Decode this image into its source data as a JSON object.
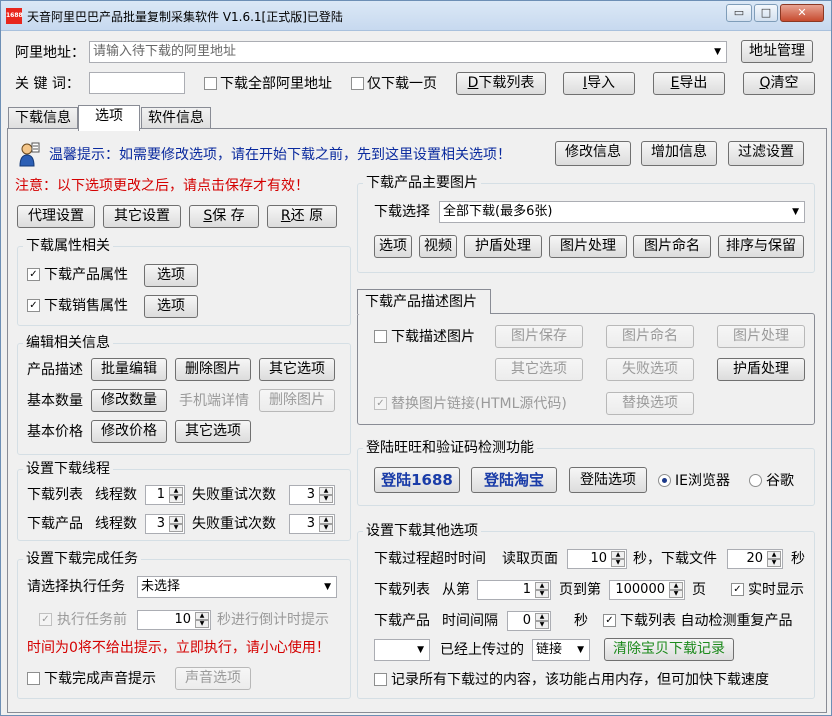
{
  "window": {
    "title": "天音阿里巴巴产品批量复制采集软件 V1.6.1[正式版]已登陆",
    "icon_text": "1688",
    "min_glyph": "▭",
    "max_glyph": "□",
    "close_glyph": "✕"
  },
  "top": {
    "address_label": "阿里地址：",
    "address_placeholder": "请输入待下载的阿里地址",
    "address_manage_btn": "地址管理",
    "keyword_label": "关 键 词：",
    "keyword_value": "",
    "download_all_label": "下载全部阿里地址",
    "download_all_checked": false,
    "only_one_page_label": "仅下载一页",
    "only_one_page_checked": false,
    "download_list_key": "D",
    "download_list_btn": "下载列表",
    "import_key": "I",
    "import_btn": "导入",
    "export_key": "E",
    "export_btn": "导出",
    "clear_key": "Q",
    "clear_btn": "清空"
  },
  "tabs": [
    "下载信息",
    "选项",
    "软件信息"
  ],
  "active_tab": "选项",
  "tip": {
    "text": "温馨提示：如需要修改选项，请在开始下载之前，先到这里设置相关选项！",
    "modify_btn": "修改信息",
    "add_btn": "增加信息",
    "filter_btn": "过滤设置"
  },
  "notice": "注意：以下选项更改之后，请点击保存才有效！",
  "actions": {
    "proxy_btn": "代理设置",
    "other_btn": "其它设置",
    "save_key": "S",
    "save_btn": "保 存",
    "restore_key": "R",
    "restore_btn": "还 原"
  },
  "download_attr": {
    "title": "下载属性相关",
    "product_attr_label": "下载产品属性",
    "product_attr_checked": true,
    "sale_attr_label": "下载销售属性",
    "sale_attr_checked": true,
    "option_btn": "选项"
  },
  "edit_info": {
    "title": "编辑相关信息",
    "desc_label": "产品描述",
    "batch_edit_btn": "批量编辑",
    "delete_img_btn": "删除图片",
    "other_option_btn": "其它选项",
    "qty_label": "基本数量",
    "modify_qty_btn": "修改数量",
    "mobile_detail_label": "手机端详情",
    "mobile_delete_img_btn": "删除图片",
    "price_label": "基本价格",
    "modify_price_btn": "修改价格",
    "price_other_btn": "其它选项"
  },
  "threads": {
    "title": "设置下载线程",
    "list_label": "下载列表",
    "product_label": "下载产品",
    "thread_label": "线程数",
    "retry_label": "失败重试次数",
    "list_threads": 1,
    "list_retry": 3,
    "product_threads": 3,
    "product_retry": 3
  },
  "complete_task": {
    "title": "设置下载完成任务",
    "select_label": "请选择执行任务",
    "select_value": "未选择",
    "countdown_before": "执行任务前",
    "countdown_value": 10,
    "countdown_after": "秒进行倒计时提示",
    "countdown_checked": true,
    "warning": "时间为0将不给出提示，立即执行，请小心使用！",
    "sound_label": "下载完成声音提示",
    "sound_checked": false,
    "sound_btn": "声音选项"
  },
  "main_image": {
    "title": "下载产品主要图片",
    "select_label": "下载选择",
    "select_value": "全部下载(最多6张)",
    "buttons": [
      "选项",
      "视频",
      "护盾处理",
      "图片处理",
      "图片命名",
      "排序与保留"
    ]
  },
  "desc_image": {
    "title": "下载产品描述图片",
    "download_label": "下载描述图片",
    "download_checked": false,
    "save_btn": "图片保存",
    "name_btn": "图片命名",
    "process_btn": "图片处理",
    "other_btn": "其它选项",
    "fail_btn": "失败选项",
    "shield_btn": "护盾处理",
    "replace_label": "替换图片链接(HTML源代码)",
    "replace_checked": true,
    "replace_btn": "替换选项"
  },
  "login": {
    "title": "登陆旺旺和验证码检测功能",
    "login1688_btn": "登陆1688",
    "taobao_btn": "登陆淘宝",
    "option_btn": "登陆选项",
    "ie_label": "IE浏览器",
    "chrome_label": "谷歌",
    "selected": "IE浏览器"
  },
  "other": {
    "title": "设置下载其他选项",
    "timeout_label": "下载过程超时时间",
    "read_page_label": "读取页面",
    "read_page_value": 10,
    "sec_file_label": "秒，下载文件",
    "file_value": 20,
    "sec_label": "秒",
    "list_label": "下载列表",
    "from_label": "从第",
    "from_value": 1,
    "to_label": "页到第",
    "to_value": 100000,
    "page_label": "页",
    "realtime_label": "实时显示",
    "realtime_checked": true,
    "product_label": "下载产品",
    "interval_label": "时间间隔",
    "interval_value": 0,
    "interval_sec": "秒",
    "auto_detect_label": "下载列表  自动检测重复产品",
    "auto_detect_checked": true,
    "uploaded_select": "",
    "uploaded_label": "已经上传过的",
    "link_select": "链接",
    "clear_record_btn": "清除宝贝下载记录",
    "record_label": "记录所有下载过的内容，该功能占用内存，但可加快下载速度",
    "record_checked": false
  }
}
